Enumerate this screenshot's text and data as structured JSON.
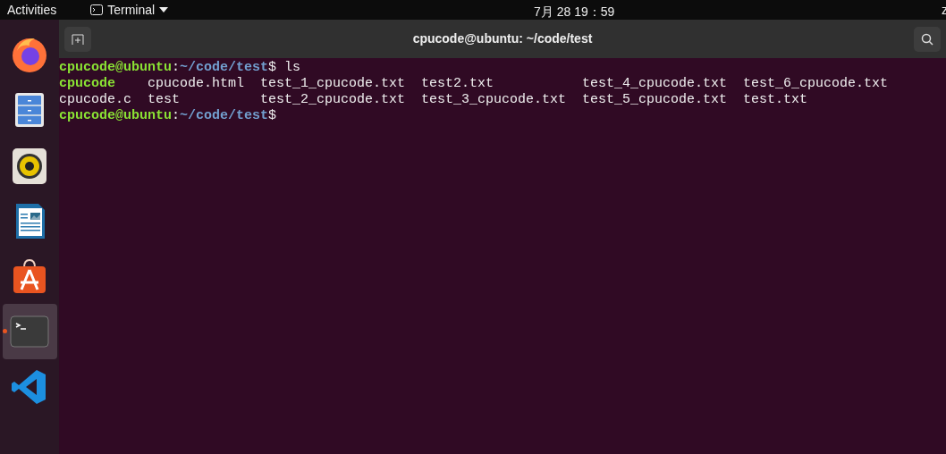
{
  "top_bar": {
    "activities": "Activities",
    "app_menu": "Terminal",
    "clock": "7月 28 19：59",
    "user_menu": "z"
  },
  "dock": {
    "items": [
      {
        "kind": "firefox",
        "selected": false
      },
      {
        "kind": "files",
        "selected": false
      },
      {
        "kind": "music",
        "selected": false
      },
      {
        "kind": "writer",
        "selected": false
      },
      {
        "kind": "store",
        "selected": false
      },
      {
        "kind": "terminal",
        "selected": true
      },
      {
        "kind": "vscode",
        "selected": false
      }
    ]
  },
  "window": {
    "title": "cpucode@ubuntu: ~/code/test"
  },
  "terminal": {
    "lines": [
      {
        "kind": "prompt",
        "user": "cpucode@ubuntu",
        "sep": ":",
        "path": "~/code/test",
        "command": "$ ls"
      },
      {
        "kind": "output",
        "entries": [
          {
            "name": "cpucode",
            "kind": "dir"
          },
          {
            "name": "cpucode.html",
            "kind": "file"
          },
          {
            "name": "test_1_cpucode.txt",
            "kind": "file"
          },
          {
            "name": "test2.txt",
            "kind": "file"
          },
          {
            "name": "test_4_cpucode.txt",
            "kind": "file"
          },
          {
            "name": "test_6_cpucode.txt",
            "kind": "file"
          }
        ]
      },
      {
        "kind": "output",
        "entries": [
          {
            "name": "cpucode.c",
            "kind": "file"
          },
          {
            "name": "test",
            "kind": "file"
          },
          {
            "name": "test_2_cpucode.txt",
            "kind": "file"
          },
          {
            "name": "test_3_cpucode.txt",
            "kind": "file"
          },
          {
            "name": "test_5_cpucode.txt",
            "kind": "file"
          },
          {
            "name": "test.txt",
            "kind": "file"
          }
        ]
      },
      {
        "kind": "prompt",
        "user": "cpucode@ubuntu",
        "sep": ":",
        "path": "~/code/test",
        "command": "$"
      }
    ]
  }
}
